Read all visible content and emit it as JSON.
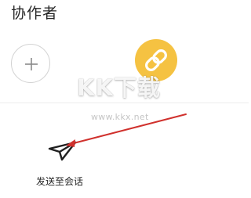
{
  "collaborators": {
    "title": "协作者",
    "add_icon": "plus-icon",
    "link_icon": "link-icon"
  },
  "share": {
    "send_to_chat_label": "发送至会话",
    "send_icon": "paper-plane-icon"
  },
  "watermark": {
    "logo_text": "KK下载",
    "url_text": "www.kkx.net"
  },
  "colors": {
    "link_button": "#f5c242",
    "annotation_arrow": "#d0312d",
    "text": "#262626"
  }
}
